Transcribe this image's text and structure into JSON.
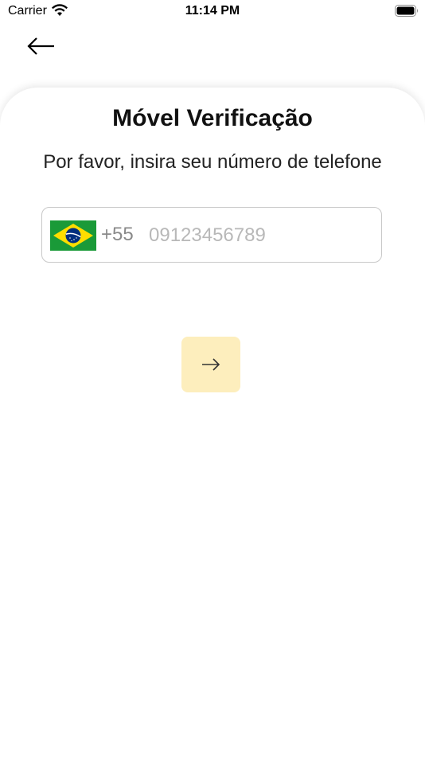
{
  "status_bar": {
    "carrier": "Carrier",
    "time": "11:14 PM"
  },
  "page": {
    "title": "Móvel Verificação",
    "subtitle": "Por favor, insira seu número de telefone"
  },
  "phone": {
    "country": "Brazil",
    "dial_code": "+55",
    "placeholder": "09123456789",
    "value": ""
  },
  "colors": {
    "button_bg": "#fdeebd",
    "flag_green": "#1a9a38",
    "flag_yellow": "#fedd00",
    "flag_blue": "#012f7f"
  },
  "icons": {
    "back": "arrow-left-icon",
    "next": "arrow-right-icon",
    "wifi": "wifi-icon",
    "battery": "battery-icon",
    "flag": "brazil-flag-icon"
  }
}
